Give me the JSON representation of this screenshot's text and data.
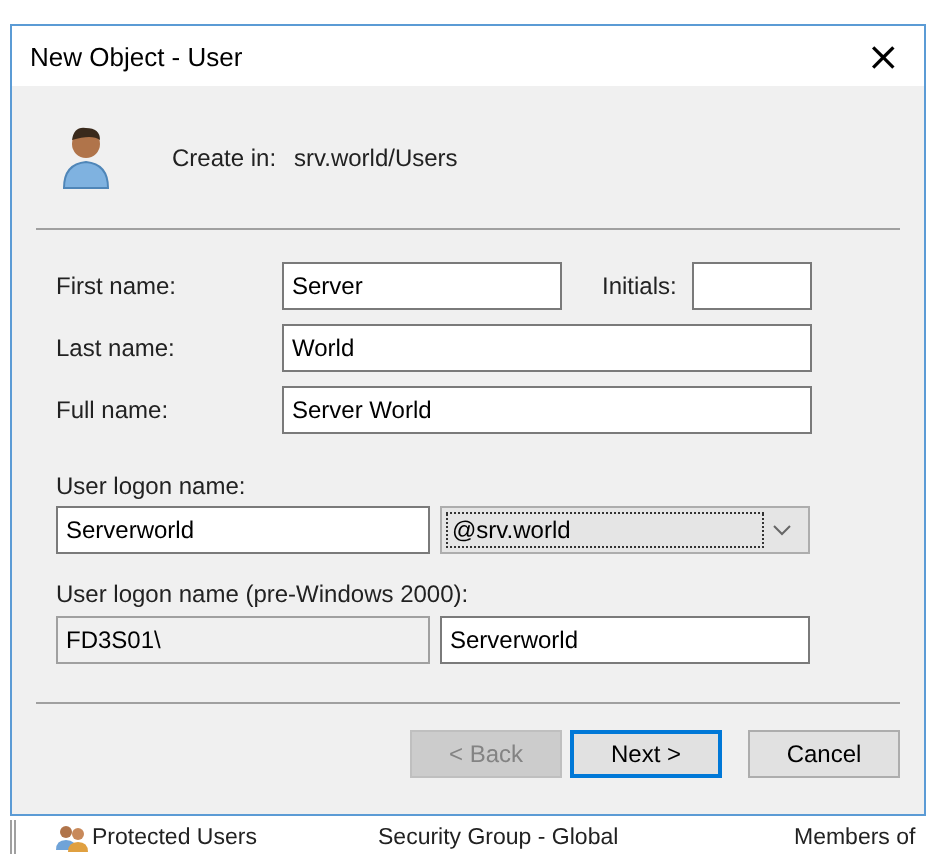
{
  "window": {
    "title": "New Object - User",
    "close": "×"
  },
  "header": {
    "label": "Create in:",
    "path": "srv.world/Users"
  },
  "fields": [
    {
      "label": "First name:",
      "value": "Server",
      "extra": {
        "label": "Initials:"
      }
    },
    {
      "label": "Last name:",
      "value": "World"
    },
    {
      "label": "Full name:",
      "value": "Server World"
    }
  ],
  "logon": {
    "label": "User logon name:",
    "value": "Serverworld",
    "domain": "@srv.world"
  },
  "legacy": {
    "label": "User logon name (pre-Windows 2000):",
    "prefix": "FD3S01\\",
    "value": "Serverworld"
  },
  "buttons": [
    {
      "label": "< Back",
      "disabled": true,
      "default": false
    },
    {
      "label": "Next >",
      "disabled": false,
      "default": true
    },
    {
      "label": "Cancel",
      "disabled": false,
      "default": false
    }
  ],
  "background_row": {
    "name": "Protected Users",
    "type": "Security Group - Global",
    "description": "Members of"
  }
}
